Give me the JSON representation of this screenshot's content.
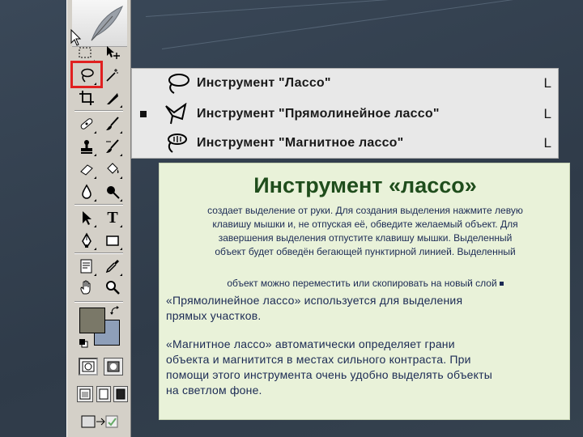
{
  "toolbox": {
    "tools": [
      {
        "name": "marquee-tool-icon"
      },
      {
        "name": "move-tool-icon"
      },
      {
        "name": "lasso-tool-icon"
      },
      {
        "name": "magic-wand-tool-icon"
      },
      {
        "name": "crop-tool-icon"
      },
      {
        "name": "slice-tool-icon"
      },
      {
        "name": "healing-brush-tool-icon"
      },
      {
        "name": "brush-tool-icon"
      },
      {
        "name": "clone-stamp-tool-icon"
      },
      {
        "name": "history-brush-tool-icon"
      },
      {
        "name": "eraser-tool-icon"
      },
      {
        "name": "paint-bucket-tool-icon"
      },
      {
        "name": "blur-tool-icon"
      },
      {
        "name": "dodge-tool-icon"
      },
      {
        "name": "path-selection-tool-icon"
      },
      {
        "name": "type-tool-icon"
      },
      {
        "name": "pen-tool-icon"
      },
      {
        "name": "rectangle-tool-icon"
      },
      {
        "name": "notes-tool-icon"
      },
      {
        "name": "eyedropper-tool-icon"
      },
      {
        "name": "hand-tool-icon"
      },
      {
        "name": "zoom-tool-icon"
      }
    ],
    "type_tool_glyph": "T",
    "foreground_color": "#7a7868",
    "background_color": "#8e9fb9",
    "highlight_color": "#e02020"
  },
  "flyout": {
    "items": [
      {
        "label": "Инструмент \"Лассо\"",
        "shortcut": "L",
        "icon": "lasso-icon",
        "selected": false
      },
      {
        "label": "Инструмент \"Прямолинейное лассо\"",
        "shortcut": "L",
        "icon": "polygonal-lasso-icon",
        "selected": true
      },
      {
        "label": "Инструмент \"Магнитное лассо\"",
        "shortcut": "L",
        "icon": "magnetic-lasso-icon",
        "selected": false
      }
    ]
  },
  "panel": {
    "title": "Инструмент «лассо»",
    "intro_lines": [
      "создает выделение от руки. Для создания выделения нажмите левую",
      "клавишу мышки и, не отпуская её, обведите желаемый объект. Для",
      "завершения выделения отпустите клавишу мышки. Выделенный",
      "объект будет обведён бегающей пунктирной линией. Выделенный"
    ],
    "intro_tail": "объект можно переместить или скопировать на новый слой",
    "polygonal_lines": [
      "«Прямолинейное лассо» используется для выделения",
      "прямых участков."
    ],
    "magnetic_lines": [
      "«Магнитное лассо» автоматически определяет грани",
      "объекта и магнитится в местах сильного контраста. При",
      "помощи этого инструмента очень удобно выделять объекты",
      "на светлом фоне."
    ]
  },
  "colors": {
    "slide_bg": "#34414f",
    "panel_bg": "#e9f2d9",
    "title_color": "#1f4d1c",
    "text_color": "#1b2a54"
  }
}
